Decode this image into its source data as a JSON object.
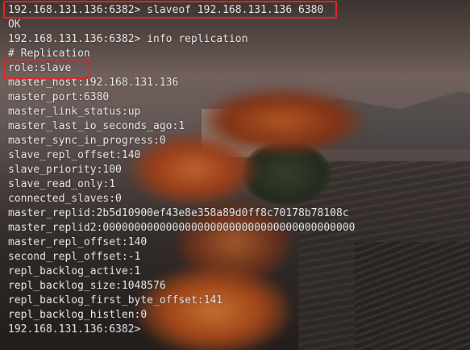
{
  "terminal": {
    "lines": [
      "192.168.131.136:6382> slaveof 192.168.131.136 6380",
      "OK",
      "192.168.131.136:6382> info replication",
      "# Replication",
      "role:slave",
      "master_host:192.168.131.136",
      "master_port:6380",
      "master_link_status:up",
      "master_last_io_seconds_ago:1",
      "master_sync_in_progress:0",
      "slave_repl_offset:140",
      "slave_priority:100",
      "slave_read_only:1",
      "connected_slaves:0",
      "master_replid:2b5d10900ef43e8e358a89d0ff8c70178b78108c",
      "master_replid2:0000000000000000000000000000000000000000",
      "master_repl_offset:140",
      "second_repl_offset:-1",
      "repl_backlog_active:1",
      "repl_backlog_size:1048576",
      "repl_backlog_first_byte_offset:141",
      "repl_backlog_histlen:0",
      "192.168.131.136:6382>"
    ],
    "highlight_color": "#e0252b"
  }
}
